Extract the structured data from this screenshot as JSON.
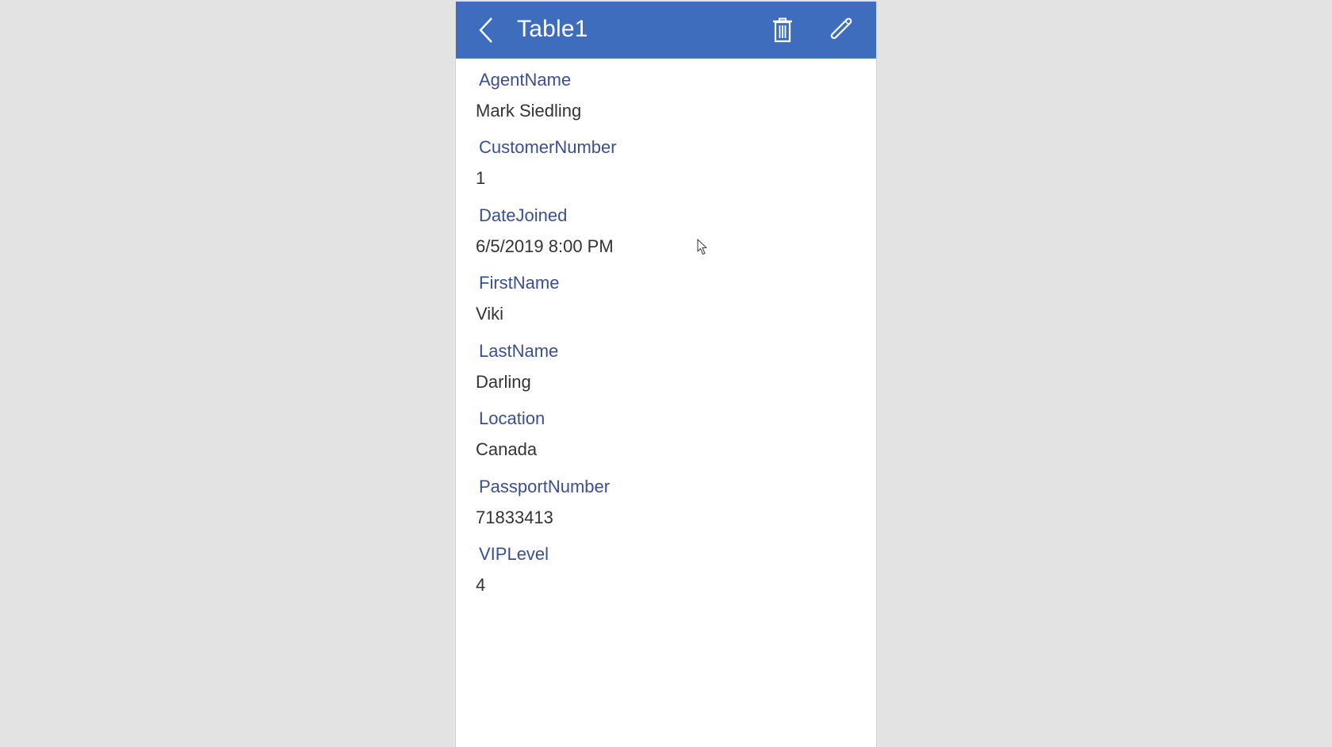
{
  "screen": {
    "header": {
      "title": "Table1",
      "back_icon": "chevron-left-icon",
      "delete_icon": "trash-icon",
      "edit_icon": "pencil-icon",
      "color": "#3f6dbd"
    },
    "fields": [
      {
        "label": "AgentName",
        "value": "Mark Siedling"
      },
      {
        "label": "CustomerNumber",
        "value": "1"
      },
      {
        "label": "DateJoined",
        "value": "6/5/2019 8:00 PM"
      },
      {
        "label": "FirstName",
        "value": "Viki"
      },
      {
        "label": "LastName",
        "value": "Darling"
      },
      {
        "label": "Location",
        "value": "Canada"
      },
      {
        "label": "PassportNumber",
        "value": "71833413"
      },
      {
        "label": "VIPLevel",
        "value": "4"
      }
    ]
  },
  "colors": {
    "header_bg": "#3f6dbd",
    "label_text": "#3b4f8f",
    "value_text": "#333333",
    "page_bg": "#e3e3e3"
  }
}
